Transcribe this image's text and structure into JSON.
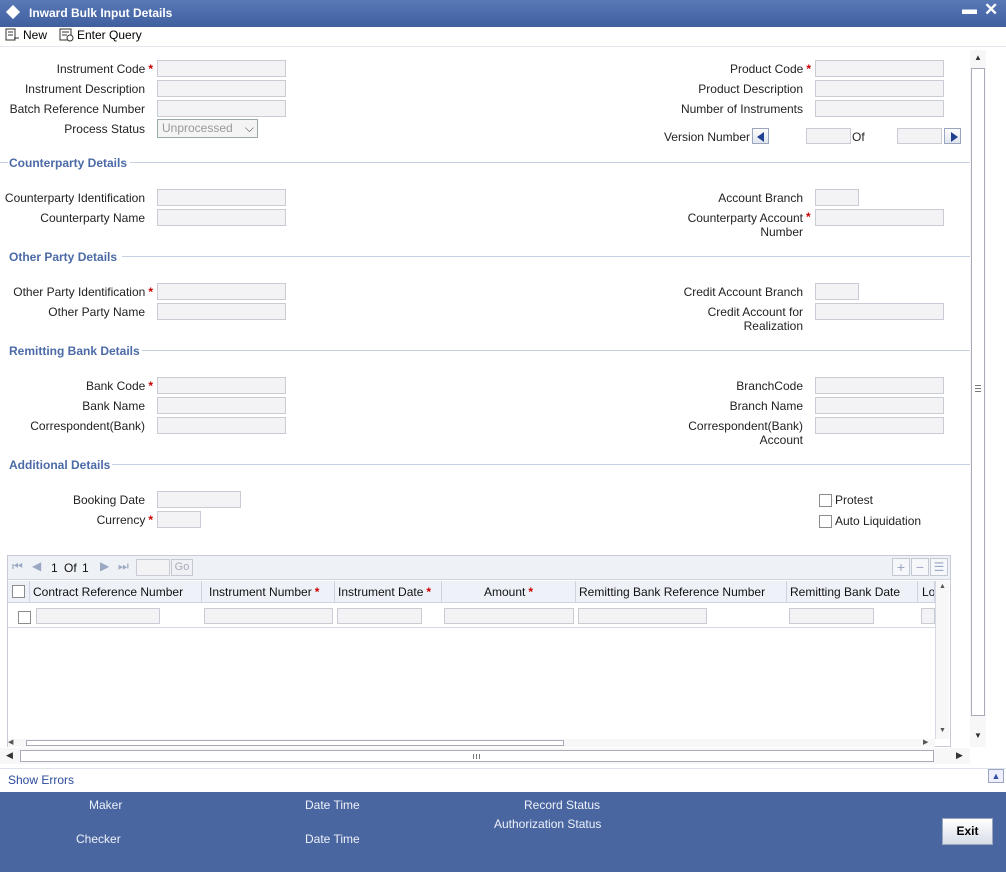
{
  "window": {
    "title": "Inward Bulk Input Details"
  },
  "toolbar": {
    "new_label": "New",
    "enter_query_label": "Enter Query"
  },
  "header_fields": {
    "instrument_code": "Instrument Code",
    "instrument_description": "Instrument Description",
    "batch_reference_number": "Batch Reference Number",
    "process_status": "Process Status",
    "process_status_value": "Unprocessed",
    "product_code": "Product Code",
    "product_description": "Product Description",
    "number_of_instruments": "Number of Instruments",
    "version_number": "Version Number",
    "of_label": "Of"
  },
  "sections": {
    "counterparty": "Counterparty Details",
    "other_party": "Other Party Details",
    "remitting_bank": "Remitting Bank Details",
    "additional": "Additional Details"
  },
  "counterparty": {
    "identification": "Counterparty Identification",
    "name": "Counterparty Name",
    "account_branch": "Account Branch",
    "account_number": "Counterparty Account Number"
  },
  "other_party": {
    "identification": "Other Party Identification",
    "name": "Other Party Name",
    "credit_account_branch": "Credit Account Branch",
    "credit_account_realization": "Credit Account for Realization"
  },
  "remitting_bank": {
    "bank_code": "Bank Code",
    "bank_name": "Bank Name",
    "correspondent": "Correspondent(Bank)",
    "branch_code": "BranchCode",
    "branch_name": "Branch Name",
    "correspondent_account": "Correspondent(Bank) Account"
  },
  "additional": {
    "booking_date": "Booking Date",
    "currency": "Currency",
    "protest": "Protest",
    "auto_liquidation": "Auto Liquidation"
  },
  "grid": {
    "page_current": "1",
    "page_of": "Of",
    "page_total": "1",
    "go_label": "Go",
    "columns": [
      "Contract Reference Number",
      "Instrument Number",
      "Instrument Date",
      "Amount",
      "Remitting Bank Reference Number",
      "Remitting Bank Date",
      "Lo"
    ]
  },
  "show_errors": "Show Errors",
  "footer": {
    "maker": "Maker",
    "maker_datetime": "Date Time",
    "checker": "Checker",
    "checker_datetime": "Date Time",
    "record_status": "Record Status",
    "authorization_status": "Authorization Status",
    "exit_label": "Exit"
  },
  "colors": {
    "title_bar": "#4a66a0",
    "section_heading": "#4b6aa6",
    "required_star": "#cc0000",
    "footer_bg": "#4a66a0"
  }
}
